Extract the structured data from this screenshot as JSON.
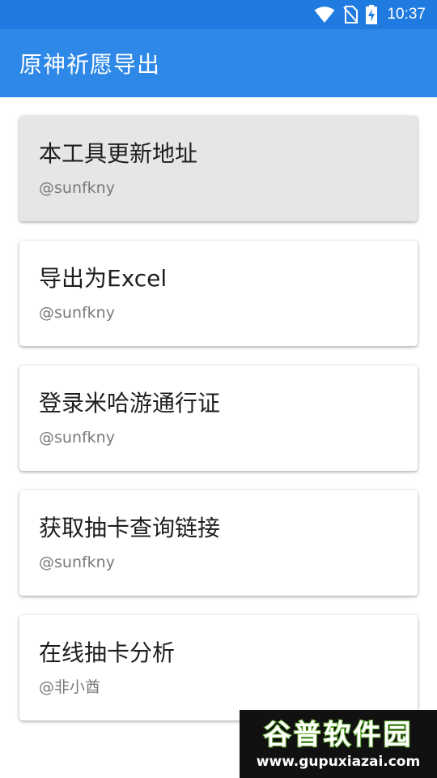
{
  "status_bar": {
    "time": "10:37",
    "icons": [
      "wifi-icon",
      "no-sim-icon",
      "battery-charging-icon"
    ]
  },
  "app_bar": {
    "title": "原神祈愿导出",
    "color": "#2e88e8"
  },
  "cards": [
    {
      "title": "本工具更新地址",
      "subtitle": "@sunfkny",
      "pressed": true
    },
    {
      "title": "导出为Excel",
      "subtitle": "@sunfkny",
      "pressed": false
    },
    {
      "title": "登录米哈游通行证",
      "subtitle": "@sunfkny",
      "pressed": false
    },
    {
      "title": "获取抽卡查询链接",
      "subtitle": "@sunfkny",
      "pressed": false
    },
    {
      "title": "在线抽卡分析",
      "subtitle": "@非小酋",
      "pressed": false
    }
  ],
  "watermark": {
    "name": "谷普软件园",
    "url": "www.gupuxiazai.com"
  }
}
